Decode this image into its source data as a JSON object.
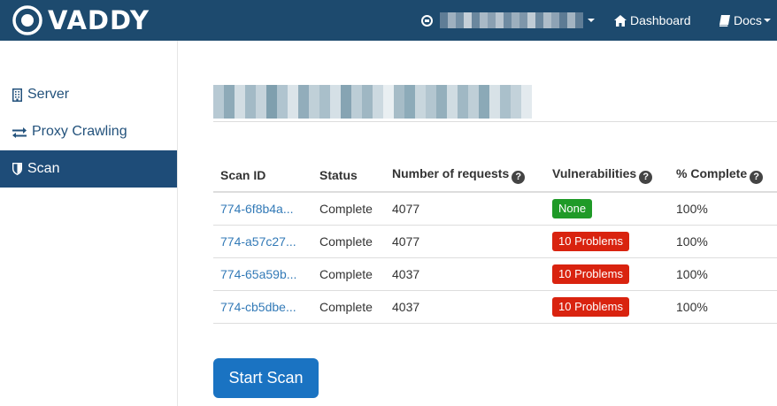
{
  "brand": {
    "logo_text": "VADDY"
  },
  "nav": {
    "user_icon": "sign-in-icon",
    "dashboard_label": "Dashboard",
    "dashboard_icon": "home-icon",
    "docs_label": "Docs",
    "docs_icon": "book-icon"
  },
  "sidebar": {
    "items": [
      {
        "label": "Server",
        "icon": "building-icon"
      },
      {
        "label": "Proxy Crawling",
        "icon": "exchange-icon"
      },
      {
        "label": "Scan",
        "icon": "shield-icon",
        "active": true
      }
    ]
  },
  "table": {
    "headers": [
      "Scan ID",
      "Status",
      "Number of requests",
      "Vulnerabilities",
      "% Complete"
    ],
    "rows": [
      {
        "scan_id": "774-6f8b4a...",
        "status": "Complete",
        "requests": "4077",
        "vulnerabilities": "None",
        "vuln_level": "ok",
        "complete": "100%"
      },
      {
        "scan_id": "774-a57c27...",
        "status": "Complete",
        "requests": "4077",
        "vulnerabilities": "10 Problems",
        "vuln_level": "bad",
        "complete": "100%"
      },
      {
        "scan_id": "774-65a59b...",
        "status": "Complete",
        "requests": "4037",
        "vulnerabilities": "10 Problems",
        "vuln_level": "bad",
        "complete": "100%"
      },
      {
        "scan_id": "774-cb5dbe...",
        "status": "Complete",
        "requests": "4037",
        "vulnerabilities": "10 Problems",
        "vuln_level": "bad",
        "complete": "100%"
      }
    ]
  },
  "actions": {
    "start_scan_label": "Start Scan"
  },
  "colors": {
    "navbar": "#1d4a6e",
    "sidebar_active": "#1e4c78",
    "link": "#337ab7",
    "badge_ok": "#1f9a27",
    "badge_bad": "#d9230f",
    "primary_button": "#1a73c2"
  }
}
